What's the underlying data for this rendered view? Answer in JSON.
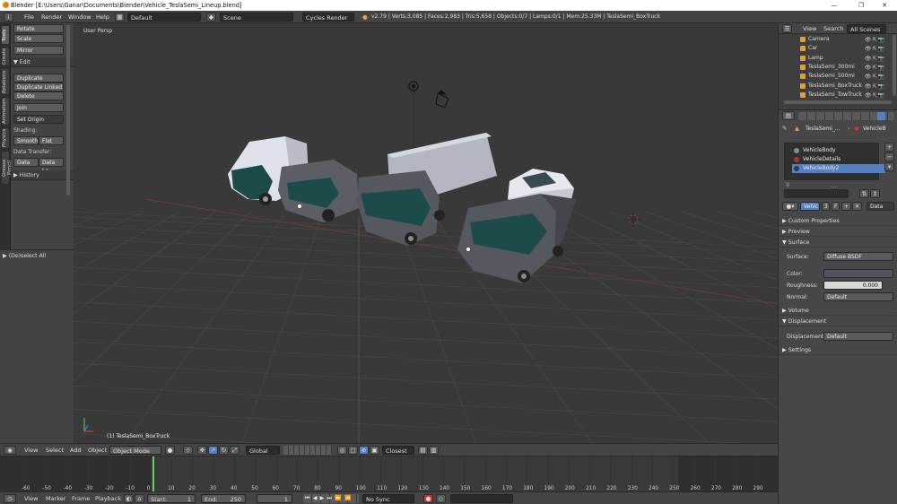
{
  "window": {
    "title": "Blender [E:\\Users\\Ganar\\Documents\\Blender\\Vehicle_TeslaSemi_Lineup.blend]",
    "minimize": "—",
    "maximize": "❐",
    "close": "✕"
  },
  "info_header": {
    "menus": [
      "File",
      "Render",
      "Window",
      "Help"
    ],
    "layout": "Default",
    "scene": "Scene",
    "engine": "Cycles Render",
    "stats": "v2.79 | Verts:3,085 | Faces:2,983 | Tris:5,658 | Objects:0/7 | Lamps:0/1 | Mem:25.33M | TeslaSemi_BoxTruck"
  },
  "tabs": [
    "Tools",
    "Create",
    "Relations",
    "Animation",
    "Physics",
    "Grease Pencil"
  ],
  "toolshelf": {
    "transform_buttons": [
      "Rotate",
      "Scale",
      "Mirror"
    ],
    "edit_header": "Edit",
    "edit_buttons": [
      "Duplicate",
      "Duplicate Linked",
      "Delete",
      "Join"
    ],
    "set_origin": "Set Origin",
    "shading_label": "Shading:",
    "smooth": "Smooth",
    "flat": "Flat",
    "data_transfer_label": "Data Transfer:",
    "data": "Data",
    "data_layout": "Data La",
    "history": "History",
    "operator": "(De)select All"
  },
  "viewport": {
    "view_label": "User Persp",
    "object_label": "(1) TeslaSemi_BoxTruck"
  },
  "view3d_header": {
    "menus": [
      "View",
      "Select",
      "Add",
      "Object"
    ],
    "mode": "Object Mode",
    "orientation": "Global",
    "snap": "Closest"
  },
  "timeline": {
    "ticks": [
      "-60",
      "-50",
      "-40",
      "-30",
      "-20",
      "-10",
      "0",
      "10",
      "20",
      "30",
      "40",
      "50",
      "60",
      "70",
      "80",
      "90",
      "100",
      "110",
      "120",
      "130",
      "140",
      "150",
      "160",
      "170",
      "180",
      "190",
      "200",
      "210",
      "220",
      "230",
      "240",
      "250",
      "260",
      "270",
      "280",
      "290"
    ],
    "current_frame": 1
  },
  "time_header": {
    "menus": [
      "View",
      "Marker",
      "Frame",
      "Playback"
    ],
    "start_label": "Start:",
    "start_value": "1",
    "end_label": "End:",
    "end_value": "250",
    "current": "1",
    "sync": "No Sync"
  },
  "outliner": {
    "menus": [
      "View",
      "Search"
    ],
    "filter": "All Scenes",
    "items": [
      {
        "name": "Camera",
        "icon": "camera-icon"
      },
      {
        "name": "Car",
        "icon": "mesh-icon"
      },
      {
        "name": "Lamp",
        "icon": "lamp-icon"
      },
      {
        "name": "TeslaSemi_300mi",
        "icon": "mesh-icon"
      },
      {
        "name": "TeslaSemi_500mi",
        "icon": "mesh-icon"
      },
      {
        "name": "TeslaSemi_BoxTruck",
        "icon": "mesh-icon"
      },
      {
        "name": "TeslaSemi_TowTruck",
        "icon": "mesh-icon"
      }
    ]
  },
  "properties": {
    "breadcrumb_object": "TeslaSemi_...",
    "breadcrumb_material": "VehicleB",
    "material_slots": [
      {
        "name": "VehicleBody",
        "color": "#8a8a96"
      },
      {
        "name": "VehicleDetails",
        "color": "#b03030"
      },
      {
        "name": "VehicleBody2",
        "color": "#2b3a5a"
      }
    ],
    "selected_slot": 2,
    "slot_dots": "....",
    "material_name": "Vehic",
    "users": "3",
    "fake_user": "F",
    "link": "Data",
    "panels": {
      "custom_properties": "Custom Properties",
      "preview": "Preview",
      "surface": "Surface",
      "volume": "Volume",
      "displacement": "Displacement",
      "settings": "Settings"
    },
    "surface_label": "Surface:",
    "surface_value": "Diffuse BSDF",
    "color_label": "Color:",
    "roughness_label": "Roughness:",
    "roughness_value": "0.000",
    "normal_label": "Normal:",
    "normal_value": "Default",
    "displacement_label": "Displacement:",
    "displacement_value": "Default"
  },
  "colors": {
    "accent": "#5680c2",
    "panel": "#474747",
    "viewport": "#393939",
    "frame_line": "#5fd35f"
  }
}
